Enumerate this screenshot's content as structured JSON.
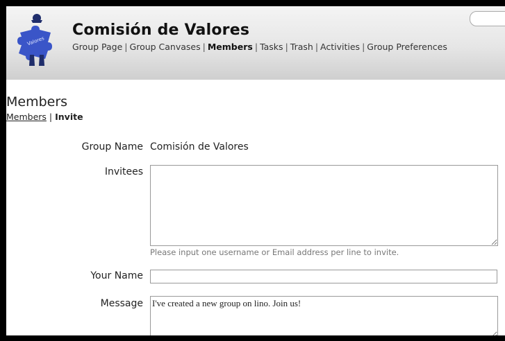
{
  "header": {
    "group_title": "Comisión de Valores",
    "nav": [
      {
        "label": "Group Page",
        "active": false
      },
      {
        "label": "Group Canvases",
        "active": false
      },
      {
        "label": "Members",
        "active": true
      },
      {
        "label": "Tasks",
        "active": false
      },
      {
        "label": "Trash",
        "active": false
      },
      {
        "label": "Activities",
        "active": false
      },
      {
        "label": "Group Preferences",
        "active": false
      }
    ],
    "separator": "|",
    "logo_text": "Valores"
  },
  "page": {
    "title": "Members",
    "subnav": {
      "members_link": "Members",
      "separator": "|",
      "current": "Invite"
    }
  },
  "form": {
    "group_name": {
      "label": "Group Name",
      "value": "Comisión de Valores"
    },
    "invitees": {
      "label": "Invitees",
      "value": "",
      "hint": "Please input one username or Email address per line to invite."
    },
    "your_name": {
      "label": "Your Name",
      "value": ""
    },
    "message": {
      "label": "Message",
      "value": "I've created a new group on lino. Join us!"
    }
  },
  "colors": {
    "logo_puzzle": "#3a55c8",
    "logo_figure": "#1f2d6b"
  }
}
